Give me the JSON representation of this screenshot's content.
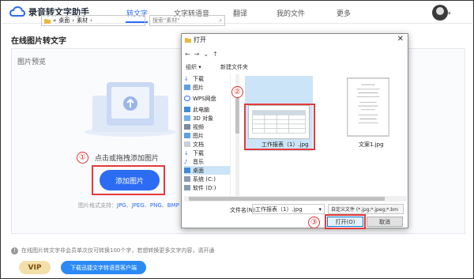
{
  "app": {
    "name": "录音转文字助手"
  },
  "nav": {
    "tabs": [
      "转文字",
      "文字转语音",
      "翻译",
      "我的文件",
      "更多"
    ]
  },
  "page": {
    "title": "在线图片转文字",
    "panel_label": "图片预览",
    "hint": "点击或拖拽添加图片",
    "add_button": "添加图片",
    "formats_prefix": "图片格式支持：",
    "formats": [
      "JPG",
      "JPEG",
      "PNG",
      "BMP"
    ],
    "notice": "在线图片转文字非会员单次仅可转换100个字，若想转换更多文字内容，请开通",
    "vip_button": "VIP",
    "download_button": "下载迅捷文字转语音客户端"
  },
  "markers": [
    "①",
    "②",
    "③"
  ],
  "dialog": {
    "title": "打开",
    "close": "✕",
    "path": [
      "«",
      "桌面",
      "›",
      "素材",
      "›"
    ],
    "search_placeholder": "搜索\"素材\"",
    "toolbar": {
      "organize": "组织 ▾",
      "new_folder": "新建文件夹"
    },
    "tree": [
      "下载",
      "图片",
      "WPS网盘",
      "此电脑",
      "3D 对象",
      "视频",
      "图片",
      "文档",
      "下载",
      "音乐",
      "桌面",
      "系统 (C:)",
      "软件 (D:)"
    ],
    "files": [
      {
        "name": "工作报表（1）.jpg"
      },
      {
        "name": "文案1.jpg"
      }
    ],
    "filename_label": "文件名(N):",
    "filename_value": "工作报表（1）.jpg",
    "filetype": "自定义文件 (*.jpg;*.jpeg;*.bm",
    "open_button": "打开(O)",
    "cancel_button": "取消"
  },
  "colors": {
    "accent": "#2b6cf3",
    "highlight": "#e23b3b",
    "selection": "#cce4f7"
  }
}
